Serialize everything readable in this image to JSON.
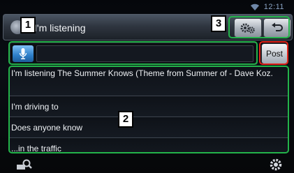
{
  "status": {
    "time": "12:11"
  },
  "header": {
    "title": "I'm listening"
  },
  "input": {
    "value": ""
  },
  "post_label": "Post",
  "messages": [
    "I'm listening The Summer Knows (Theme from Summer of - Dave Koz.",
    "I'm driving to",
    "Does anyone know",
    "...in the traffic"
  ],
  "callouts": [
    "1",
    "2",
    "3"
  ],
  "icons": {
    "app": "app-icon",
    "settings": "settings-gears-icon",
    "back": "back-arrow-icon",
    "mic": "microphone-icon",
    "wifi": "wifi-icon",
    "bottom_left": "search-icon",
    "bottom_right": "gear-icon"
  },
  "colors": {
    "highlight_green": "#23b34a",
    "highlight_red": "#e2231a",
    "mic_blue": "#2d7ec9"
  }
}
